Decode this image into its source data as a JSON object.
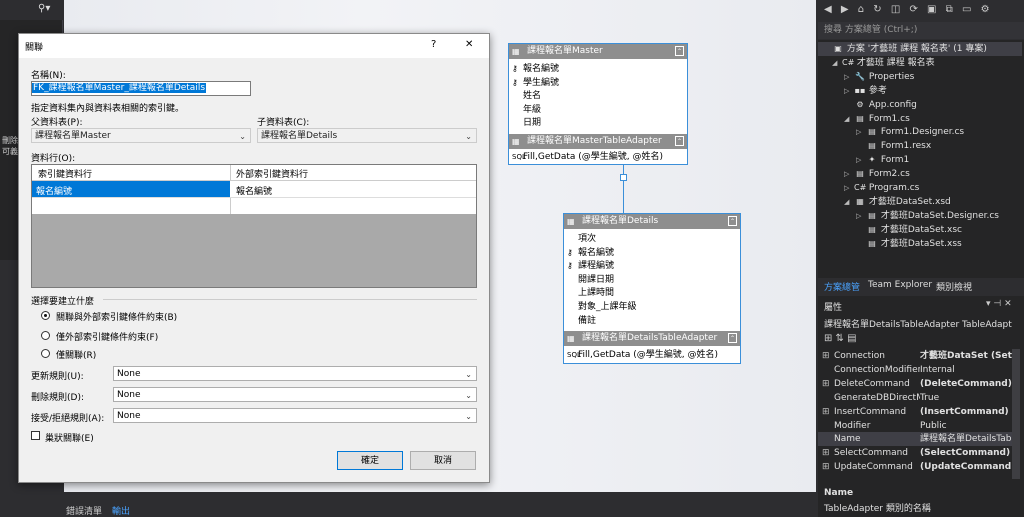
{
  "dialog": {
    "title": "關聯",
    "help": "?",
    "close": "✕",
    "name_label": "名稱(N):",
    "name_value": "FK_課程報名單Master_課程報名單Details",
    "hint": "指定資料集內與資料表相關的索引鍵。",
    "parent_label": "父資料表(P):",
    "parent_value": "課程報名單Master",
    "child_label": "子資料表(C):",
    "child_value": "課程報名單Details",
    "columns_label": "資料行(O):",
    "col_header_key": "索引鍵資料行",
    "col_header_foreign": "外部索引鍵資料行",
    "col_row_key": "報名編號",
    "col_row_foreign": "報名編號",
    "choose_label": "選擇要建立什麼",
    "radio1": "關聯與外部索引鍵條件約束(B)",
    "radio2": "僅外部索引鍵條件約束(F)",
    "radio3": "僅關聯(R)",
    "update_label": "更新規則(U):",
    "update_value": "None",
    "delete_label": "刪除規則(D):",
    "delete_value": "None",
    "accept_label": "接受/拒絕規則(A):",
    "accept_value": "None",
    "nested_label": "巢狀關聯(E)",
    "ok": "確定",
    "cancel": "取消"
  },
  "master": {
    "title": "課程報名單Master",
    "fields": [
      "報名編號",
      "學生編號",
      "姓名",
      "年級",
      "日期"
    ],
    "adapter_title": "課程報名單MasterTableAdapter",
    "adapter_method": "Fill,GetData (@學生編號, @姓名)"
  },
  "details": {
    "title": "課程報名單Details",
    "fields": [
      "項次",
      "報名編號",
      "課程編號",
      "開課日期",
      "上課時間",
      "對象_上課年級",
      "備註"
    ],
    "adapter_title": "課程報名單DetailsTableAdapter",
    "adapter_method": "Fill,GetData (@學生編號, @姓名)"
  },
  "left_panel": {
    "line1": "刪除",
    "line2": "可義"
  },
  "bottom_tabs": {
    "tab1": "錯誤清單",
    "tab2": "輸出"
  },
  "solution": {
    "search": "搜尋 方案總管 (Ctrl+;)",
    "items": [
      "方案 '才藝班 課程 報名表' (1 專案)",
      "才藝班 課程 報名表",
      "Properties",
      "參考",
      "App.config",
      "Form1.cs",
      "Form1.Designer.cs",
      "Form1.resx",
      "Form1",
      "Form2.cs",
      "Program.cs",
      "才藝班DataSet.xsd",
      "才藝班DataSet.Designer.cs",
      "才藝班DataSet.xsc",
      "才藝班DataSet.xss"
    ],
    "tabs": [
      "方案總管",
      "Team Explorer",
      "類別檢視"
    ]
  },
  "properties": {
    "header": "屬性",
    "object": "課程報名單DetailsTableAdapter  TableAdapt",
    "rows": [
      {
        "name": "Connection",
        "value": "才藝班DataSet (Setti"
      },
      {
        "name": "ConnectionModifier",
        "value": "Internal"
      },
      {
        "name": "DeleteCommand",
        "value": "(DeleteCommand)"
      },
      {
        "name": "GenerateDBDirectM",
        "value": "True"
      },
      {
        "name": "InsertCommand",
        "value": "(InsertCommand)"
      },
      {
        "name": "Modifier",
        "value": "Public"
      },
      {
        "name": "Name",
        "value": "課程報名單DetailsTab"
      },
      {
        "name": "SelectCommand",
        "value": "(SelectCommand)"
      },
      {
        "name": "UpdateCommand",
        "value": "(UpdateCommand)"
      }
    ],
    "desc_title": "Name",
    "desc_text": "TableAdapter 類別的名稱"
  }
}
